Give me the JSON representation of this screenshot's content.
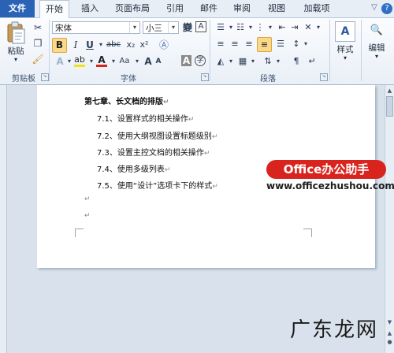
{
  "tabs": [
    "文件",
    "开始",
    "插入",
    "页面布局",
    "引用",
    "邮件",
    "审阅",
    "视图",
    "加载项"
  ],
  "window_controls": {
    "minimize": "▽",
    "help": "?"
  },
  "clipboard": {
    "paste_label": "粘贴",
    "group_label": "剪贴板"
  },
  "font": {
    "name": "宋体",
    "size": "小三",
    "group_label": "字体",
    "phonetic": "變",
    "border_char": "A",
    "circle_char": "字"
  },
  "paragraph": {
    "group_label": "段落"
  },
  "styles": {
    "label": "样式"
  },
  "editing": {
    "label": "编辑"
  },
  "document": {
    "heading": "第七章、长文档的排版",
    "items": [
      "7.1、设置样式的相关操作",
      "7.2、使用大纲视图设置标题级别",
      "7.3、设置主控文档的相关操作",
      "7.4、使用多级列表",
      "7.5、使用“设计”选项卡下的样式"
    ],
    "para_mark": "↵"
  },
  "watermark": {
    "brand": "Office办公助手",
    "url": "www.officezhushou.com",
    "logo": "广东龙网"
  },
  "colors": {
    "file_tab": "#2a63b5",
    "highlight": "#f2e21a",
    "font_color": "#d5261e",
    "watermark_bg": "#d9241e"
  }
}
